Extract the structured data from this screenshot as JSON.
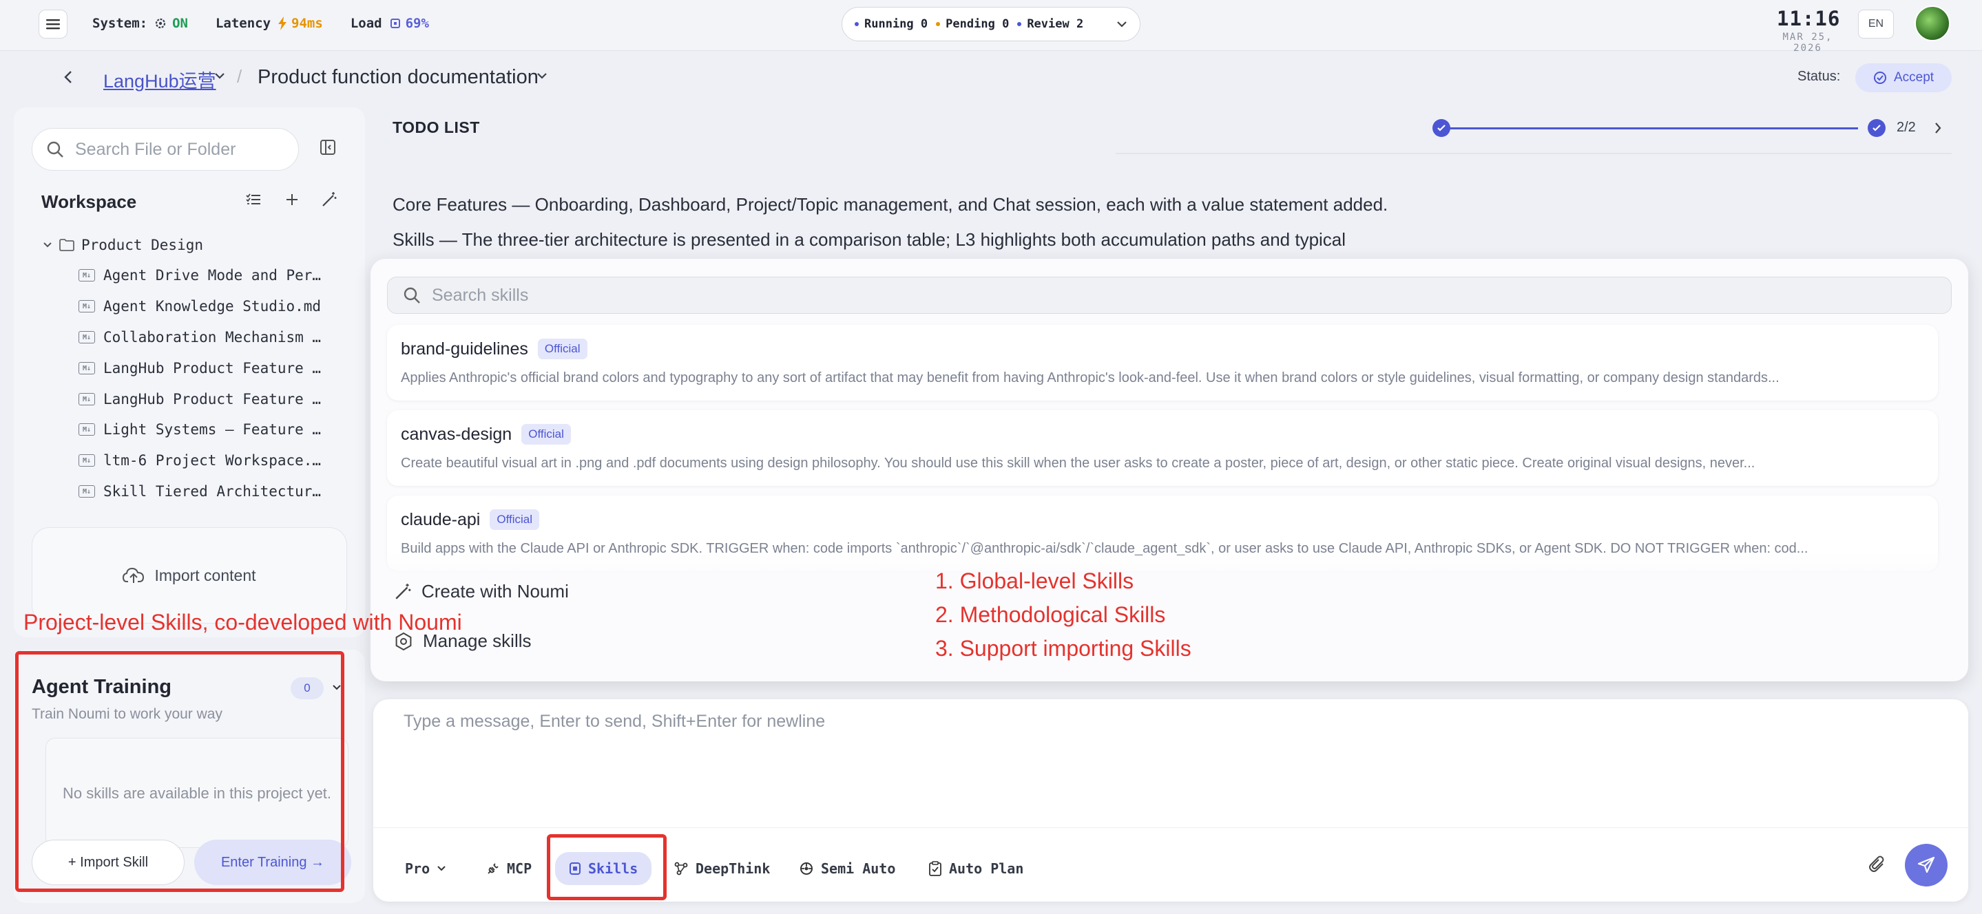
{
  "topbar": {
    "system_label": "System:",
    "system_value": "ON",
    "latency_label": "Latency",
    "latency_value": "94ms",
    "load_label": "Load",
    "load_value": "69%",
    "queue": [
      {
        "label": "Running",
        "count": "0",
        "color": "#4c56d4"
      },
      {
        "label": "Pending",
        "count": "0",
        "color": "#e69500"
      },
      {
        "label": "Review",
        "count": "2",
        "color": "#4c56d4"
      }
    ],
    "time_h": "11",
    "time_sep": ":",
    "time_m": "16",
    "date": "Mar 25, 2026",
    "lang": "EN"
  },
  "breadcrumb": {
    "project": "LangHub运营",
    "separator": "/",
    "page": "Product function documentation"
  },
  "status": {
    "label": "Status:",
    "value": "Accept"
  },
  "sidebar": {
    "search_placeholder": "Search File or Folder",
    "workspace_title": "Workspace",
    "folder": "Product Design",
    "files": [
      "Agent Drive Mode and Per…",
      "Agent Knowledge Studio.md",
      "Collaboration Mechanism …",
      "LangHub Product Feature …",
      "LangHub Product Feature …",
      "Light Systems — Feature …",
      "ltm-6 Project Workspace.…",
      "Skill Tiered Architectur…"
    ],
    "import_label": "Import content"
  },
  "agent_training": {
    "title": "Agent Training",
    "badge": "0",
    "subtitle": "Train Noumi to work your way",
    "empty_text": "No skills are available in this project yet.",
    "import_button": "+ Import Skill",
    "enter_button": "Enter Training →"
  },
  "todo": {
    "title": "TODO LIST",
    "progress_text": "2/2",
    "progress_fraction": 1.0,
    "lines": [
      "Core Features — Onboarding, Dashboard, Project/Topic management, and Chat session, each with a value statement added.",
      "Skills — The three-tier architecture is presented in a comparison table; L3 highlights both accumulation paths and typical"
    ]
  },
  "skills_popup": {
    "search_placeholder": "Search skills",
    "items": [
      {
        "name": "brand-guidelines",
        "badge": "Official",
        "desc": "Applies Anthropic's official brand colors and typography to any sort of artifact that may benefit from having Anthropic's look-and-feel. Use it when brand colors or style guidelines, visual formatting, or company design standards..."
      },
      {
        "name": "canvas-design",
        "badge": "Official",
        "desc": "Create beautiful visual art in .png and .pdf documents using design philosophy. You should use this skill when the user asks to create a poster, piece of art, design, or other static piece. Create original visual designs, never..."
      },
      {
        "name": "claude-api",
        "badge": "Official",
        "desc": "Build apps with the Claude API or Anthropic SDK. TRIGGER when: code imports `anthropic`/`@anthropic-ai/sdk`/`claude_agent_sdk`, or user asks to use Claude API, Anthropic SDKs, or Agent SDK. DO NOT TRIGGER when: cod..."
      }
    ],
    "create_label": "Create with Noumi",
    "manage_label": "Manage skills"
  },
  "annotations": {
    "left": "Project-level Skills, co-developed with Noumi",
    "right": [
      "1. Global-level Skills",
      "2. Methodological Skills",
      "3. Support importing Skills"
    ]
  },
  "chat": {
    "placeholder": "Type a message, Enter to send, Shift+Enter for newline",
    "tools": {
      "model": "Pro",
      "mcp": "MCP",
      "skills": "Skills",
      "deepthink": "DeepThink",
      "semi_auto": "Semi Auto",
      "auto_plan": "Auto Plan"
    }
  },
  "colors": {
    "accent": "#4c56d4",
    "annotation": "#e5322d",
    "on": "#1f9d55",
    "warning": "#e69500"
  }
}
